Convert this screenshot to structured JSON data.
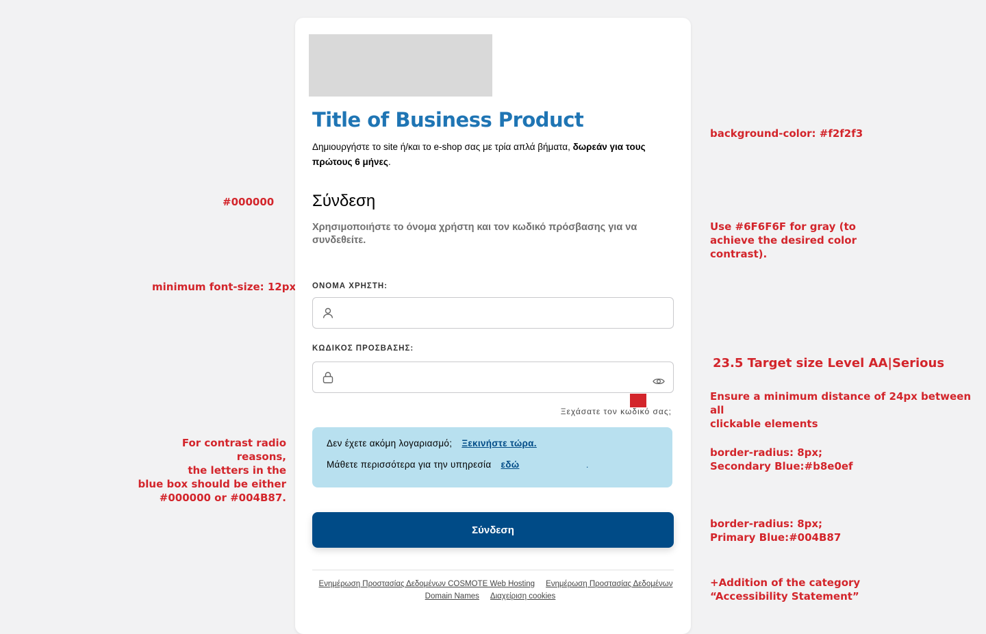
{
  "colors": {
    "background": "#f2f2f3",
    "title_blue": "#1f75b4",
    "primary_blue": "#004b87",
    "secondary_blue": "#b8e0ef",
    "gray_text": "#6f6f6f",
    "annotation_red": "#d3252b"
  },
  "annotations": {
    "black_color": "#000000",
    "min_font_size": "minimum font-size: 12px",
    "contrast_radio": [
      "For contrast radio reasons,",
      "the letters in the",
      "blue box should be either",
      "#000000 or #004B87."
    ],
    "background_color": "background-color: #f2f2f3",
    "gray_usage": [
      "Use #6F6F6F for gray (to",
      "achieve the desired color",
      "contrast)."
    ],
    "target_size_title": "23.5 Target size Level AA|Serious",
    "target_size_desc": [
      "Ensure a minimum distance of 24px between all",
      "clickable elements"
    ],
    "secondary_box": [
      "border-radius: 8px;",
      "Secondary Blue:#b8e0ef"
    ],
    "primary_button": [
      "border-radius: 8px;",
      "Primary Blue:#004B87"
    ],
    "accessibility": [
      "+Addition of the category",
      "“Accessibility Statement”"
    ]
  },
  "card": {
    "product_title": "Title of Business Product",
    "intro_text": "Δημιουργήστε το site ή/και το e-shop σας με τρία απλά βήματα, ",
    "intro_bold": "δωρεάν για τους πρώτους 6 μήνες",
    "intro_end": ".",
    "login_heading": "Σύνδεση",
    "login_help": "Χρησιμοποιήστε το όνομα χρήστη και τον κωδικό πρόσβασης για να συνδεθείτε.",
    "username_label": "ΟΝΟΜΑ ΧΡΗΣΤΗ:",
    "username_value": "",
    "password_label": "ΚΩΔΙΚΟΣ ΠΡΟΣΒΑΣΗΣ:",
    "password_value": "",
    "forgot_password": "Ξεχάσατε τον κωδικό σας;",
    "info_box": {
      "no_account_text": "Δεν έχετε ακόμη λογαριασμό;",
      "start_now_link": "Ξεκινήστε τώρα.",
      "learn_more_text": "Μάθετε περισσότερα για την υπηρεσία",
      "here_link": "εδώ",
      "dot": "."
    },
    "submit_label": "Σύνδεση",
    "footer_links": [
      "Ενημέρωση Προστασίας Δεδομένων COSMOTE Web Hosting",
      "Ενημέρωση Προστασίας Δεδομένων Domain Names",
      "Διαχείριση cookies"
    ]
  }
}
